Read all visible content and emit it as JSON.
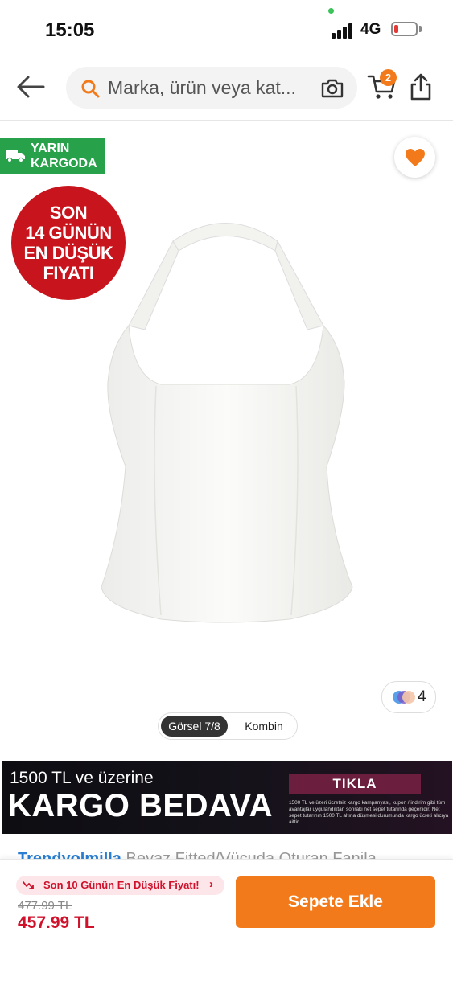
{
  "status_bar": {
    "time": "15:05",
    "network": "4G"
  },
  "header": {
    "search_placeholder": "Marka, ürün veya kat...",
    "cart_count": "2"
  },
  "badges": {
    "cargo_line1": "YARIN",
    "cargo_line2": "KARGODA",
    "lowest_line1": "SON",
    "lowest_line2": "14 GÜNÜN",
    "lowest_line3": "EN DÜŞÜK",
    "lowest_line4": "FIYATI"
  },
  "gallery": {
    "variant_count": "4",
    "tab_active": "Görsel 7/8",
    "tab_other": "Kombin"
  },
  "banner": {
    "line1": "1500 TL ve üzerine",
    "line2": "KARGO BEDAVA",
    "button": "TIKLA",
    "small_text": "1500 TL ve üzeri ücretsiz kargo kampanyası, kupon / indirim gibi tüm avantajlar uygulandıktan sonraki net sepet tutarında geçerlidir. Net sepet tutarının 1500 TL altına düşmesi durumunda kargo ücreti alıcıya aittir."
  },
  "product_title_peek": {
    "brand": "Trendyolmilla",
    "rest": "Beyaz Fitted/Vücuda Oturan Fanila"
  },
  "bottom_bar": {
    "lowest_pill": "Son 10 Günün En Düşük Fiyatı!",
    "old_price": "477.99 TL",
    "new_price": "457.99 TL",
    "add_to_cart": "Sepete Ekle"
  },
  "colors": {
    "accent": "#f27a1a",
    "cargo_green": "#27a24a",
    "badge_red": "#c8141c",
    "price_red": "#d0112b"
  }
}
